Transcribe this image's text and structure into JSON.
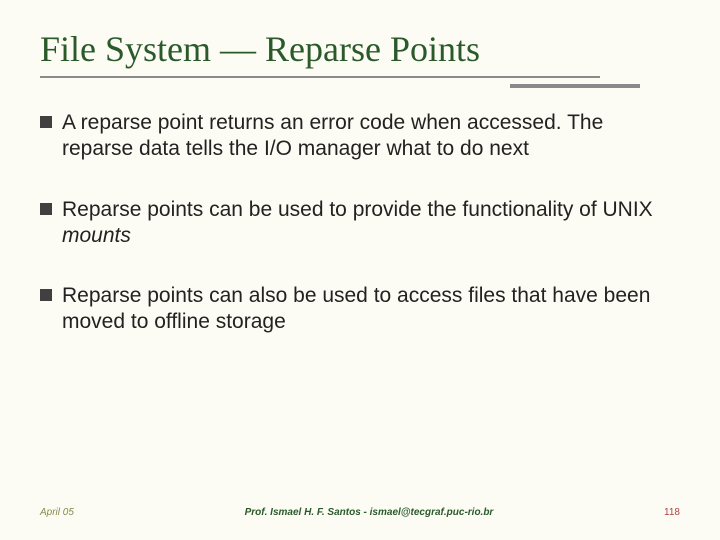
{
  "title": "File System — Reparse Points",
  "bullets": [
    {
      "text": "A reparse point returns an error code when accessed. The reparse data tells the I/O manager what to do next"
    },
    {
      "text_prefix": "Reparse points can be used to provide the functionality of UNIX ",
      "italic": "mounts"
    },
    {
      "text": "Reparse points can also be used to access files that have been moved to offline storage"
    }
  ],
  "footer": {
    "date": "April 05",
    "author": "Prof. Ismael H. F. Santos - ismael@tecgraf.puc-rio.br",
    "page": "118"
  }
}
